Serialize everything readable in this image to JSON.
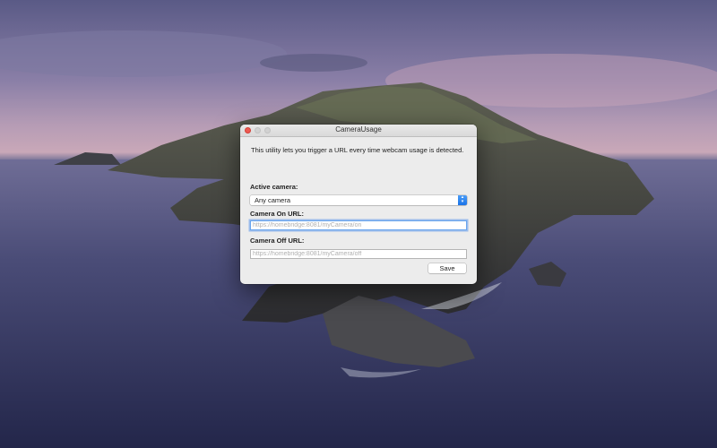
{
  "window": {
    "title": "CameraUsage",
    "intro_text": "This utility lets you trigger a URL every time webcam usage is detected."
  },
  "active_camera": {
    "label": "Active camera:",
    "selected": "Any camera"
  },
  "camera_on": {
    "label": "Camera On URL:",
    "value": "",
    "placeholder": "https://homebridge:8081/myCamera/on"
  },
  "camera_off": {
    "label": "Camera Off URL:",
    "value": "",
    "placeholder": "https://homebridge:8081/myCamera/off"
  },
  "buttons": {
    "save_label": "Save"
  },
  "colors": {
    "close_button": "#ee5a52",
    "focus_ring": "#6aa6ee",
    "popup_accent": "#1a73e8"
  }
}
